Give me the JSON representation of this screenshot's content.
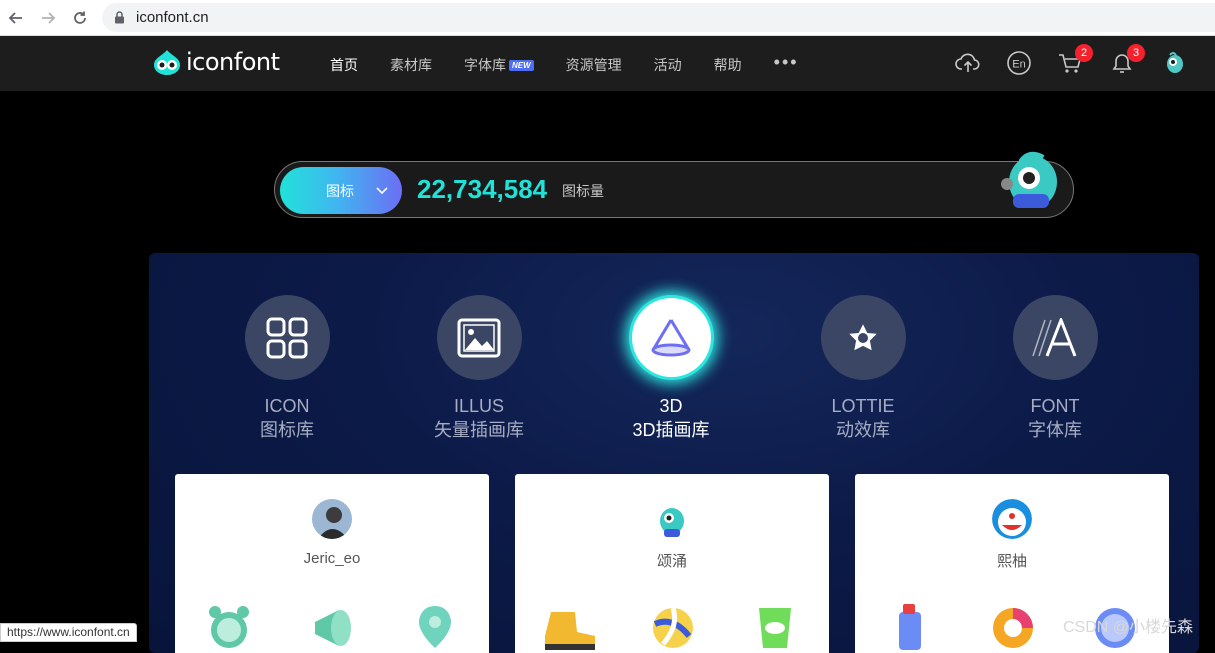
{
  "browser": {
    "url": "iconfont.cn",
    "status_url": "https://www.iconfont.cn"
  },
  "header": {
    "logo_text": "iconfont",
    "menu": [
      {
        "label": "首页",
        "active": true
      },
      {
        "label": "素材库"
      },
      {
        "label": "字体库",
        "badge": "NEW"
      },
      {
        "label": "资源管理"
      },
      {
        "label": "活动"
      },
      {
        "label": "帮助"
      }
    ],
    "more_label": "•••",
    "lang_label": "En",
    "cart_count": "2",
    "notification_count": "3",
    "icons": [
      "upload-icon",
      "language-icon",
      "cart-icon",
      "bell-icon",
      "avatar"
    ]
  },
  "search": {
    "type_label": "图标",
    "count": "22,734,584",
    "count_label": "图标量"
  },
  "categories": [
    {
      "en": "ICON",
      "cn": "图标库",
      "icon": "grid-icon"
    },
    {
      "en": "ILLUS",
      "cn": "矢量插画库",
      "icon": "image-icon"
    },
    {
      "en": "3D",
      "cn": "3D插画库",
      "icon": "cone-icon",
      "active": true
    },
    {
      "en": "LOTTIE",
      "cn": "动效库",
      "icon": "star-shape-icon"
    },
    {
      "en": "FONT",
      "cn": "字体库",
      "icon": "font-icon"
    }
  ],
  "cards": [
    {
      "author": "Jeric_eo"
    },
    {
      "author": "颂涌"
    },
    {
      "author": "熙柚"
    }
  ],
  "watermark": "CSDN @小楼先森",
  "colors": {
    "accent": "#21e2d8",
    "badge": "#f5222d",
    "panel": "#0c1a48",
    "header": "#1d1d1d"
  }
}
